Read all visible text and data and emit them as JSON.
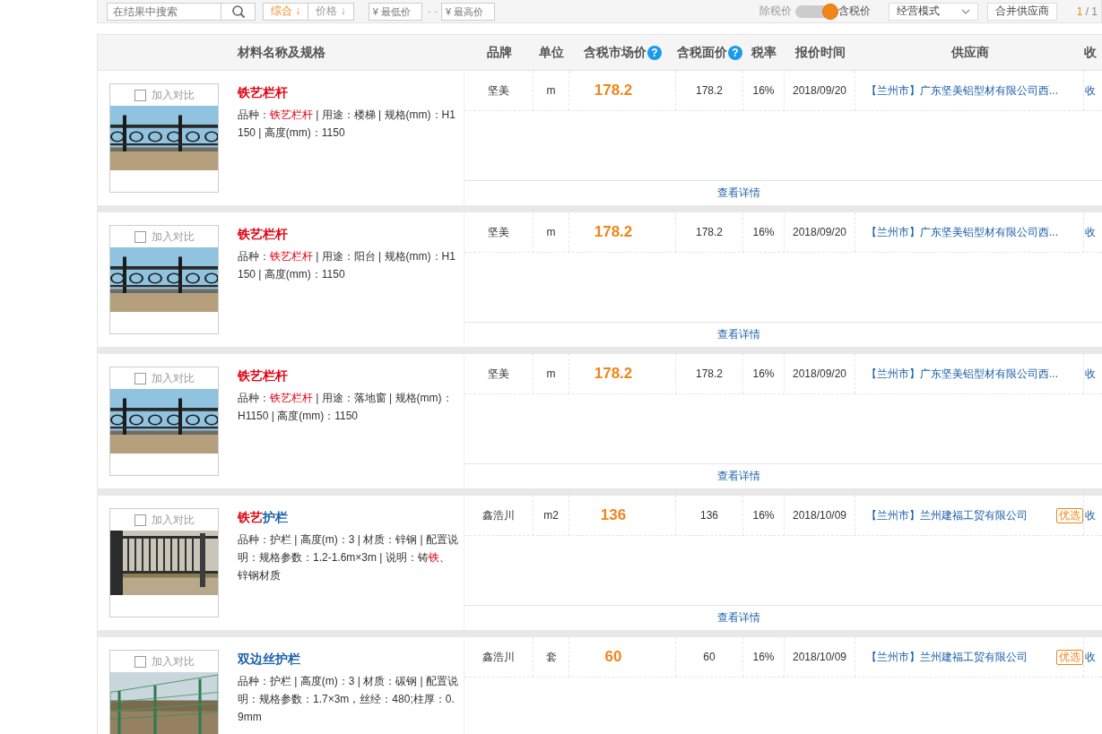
{
  "toolbar": {
    "search": {
      "placeholder": "在结果中搜索"
    },
    "sorts": [
      {
        "label": "综合",
        "arrow": "↓",
        "selected": true
      },
      {
        "label": "价格",
        "arrow": "↓",
        "selected": false
      }
    ],
    "price_min": {
      "placeholder": "¥ 最低价"
    },
    "range_dash": "- -",
    "price_max": {
      "placeholder": "¥ 最高价"
    },
    "tax_toggle": {
      "off_label": "除税价",
      "on_label": "含税价",
      "on": true
    },
    "mode_select": {
      "value": "经营模式"
    },
    "merge_button": "合并供应商",
    "pager": {
      "current": "1",
      "separator": "/",
      "total": "1"
    }
  },
  "table": {
    "columns": [
      {
        "label": "材料名称及规格"
      },
      {
        "label": "品牌"
      },
      {
        "label": "单位"
      },
      {
        "label": "含税市场价",
        "help": "?"
      },
      {
        "label": "含税面价",
        "help": "?"
      },
      {
        "label": "税率"
      },
      {
        "label": "报价时间"
      },
      {
        "label": "供应商"
      },
      {
        "label": "收"
      }
    ],
    "rows": [
      {
        "compare": {
          "label": "加入对比",
          "checked": false
        },
        "title": [
          {
            "text": "铁艺栏杆",
            "highlight": true
          }
        ],
        "spec": [
          {
            "text": "品种："
          },
          {
            "text": "铁艺栏杆",
            "highlight": true
          },
          {
            "text": " | 用途：楼梯 | 规格(mm)：H1150 | 高度(mm)：1150"
          }
        ],
        "brand": "坚美",
        "unit": "m",
        "price": "178.2",
        "face_price": "178.2",
        "tax_rate": "16%",
        "date": "2018/09/20",
        "supplier_city": "【兰州市】",
        "supplier": "广东坚美铝型材有限公司西...",
        "collect": "收",
        "detail_link": "查看详情"
      },
      {
        "compare": {
          "label": "加入对比",
          "checked": false
        },
        "title": [
          {
            "text": "铁艺栏杆",
            "highlight": true
          }
        ],
        "spec": [
          {
            "text": "品种："
          },
          {
            "text": "铁艺栏杆",
            "highlight": true
          },
          {
            "text": " | 用途：阳台 | 规格(mm)：H1150 | 高度(mm)：1150"
          }
        ],
        "brand": "坚美",
        "unit": "m",
        "price": "178.2",
        "face_price": "178.2",
        "tax_rate": "16%",
        "date": "2018/09/20",
        "supplier_city": "【兰州市】",
        "supplier": "广东坚美铝型材有限公司西...",
        "collect": "收",
        "detail_link": "查看详情"
      },
      {
        "compare": {
          "label": "加入对比",
          "checked": false
        },
        "title": [
          {
            "text": "铁艺栏杆",
            "highlight": true
          }
        ],
        "spec": [
          {
            "text": "品种："
          },
          {
            "text": "铁艺栏杆",
            "highlight": true
          },
          {
            "text": " | 用途：落地窗 | 规格(mm)：H1150 | 高度(mm)：1150"
          }
        ],
        "brand": "坚美",
        "unit": "m",
        "price": "178.2",
        "face_price": "178.2",
        "tax_rate": "16%",
        "date": "2018/09/20",
        "supplier_city": "【兰州市】",
        "supplier": "广东坚美铝型材有限公司西...",
        "collect": "收",
        "detail_link": "查看详情"
      },
      {
        "compare": {
          "label": "加入对比",
          "checked": false
        },
        "title": [
          {
            "text": "铁艺",
            "highlight": true
          },
          {
            "text": "护栏",
            "highlight": false
          }
        ],
        "spec": [
          {
            "text": "品种：护栏 | 高度(m)：3 | 材质：锌钢 | 配置说明：规格参数：1.2-1.6m×3m | 说明：铸"
          },
          {
            "text": "铁",
            "highlight": true
          },
          {
            "text": "、锌钢材质"
          }
        ],
        "brand": "鑫浩川",
        "unit": "m2",
        "price": "136",
        "face_price": "136",
        "tax_rate": "16%",
        "date": "2018/10/09",
        "supplier_city": "【兰州市】",
        "supplier": "兰州建福工贸有限公司",
        "badge": "优选",
        "collect": "收",
        "detail_link": "查看详情"
      },
      {
        "compare": {
          "label": "加入对比",
          "checked": false
        },
        "title": [
          {
            "text": "双边丝护栏",
            "highlight": false
          }
        ],
        "spec": [
          {
            "text": "品种：护栏 | 高度(m)：3 | 材质：碳钢 | 配置说明：规格参数：1.7×3m，丝经：480;柱厚：0.9mm"
          }
        ],
        "brand": "鑫浩川",
        "unit": "套",
        "price": "60",
        "face_price": "60",
        "tax_rate": "16%",
        "date": "2018/10/09",
        "supplier_city": "【兰州市】",
        "supplier": "兰州建福工贸有限公司",
        "badge": "优选",
        "collect": "收"
      }
    ]
  }
}
